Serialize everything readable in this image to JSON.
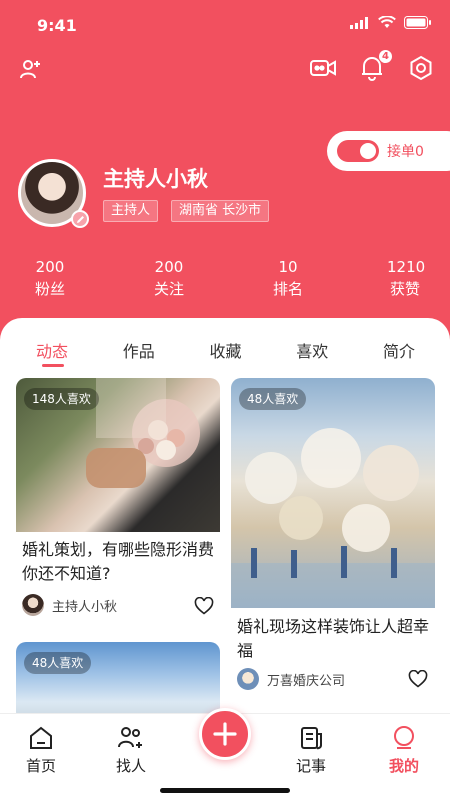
{
  "status_bar": {
    "time": "9:41"
  },
  "header": {
    "notification_count": "4",
    "order_toggle": {
      "label": "接单0",
      "on": true
    },
    "profile": {
      "name": "主持人小秋",
      "tags": [
        "主持人",
        "湖南省 长沙市"
      ]
    },
    "stats": [
      {
        "value": "200",
        "label": "粉丝"
      },
      {
        "value": "200",
        "label": "关注"
      },
      {
        "value": "10",
        "label": "排名"
      },
      {
        "value": "1210",
        "label": "获赞"
      }
    ]
  },
  "tabs": [
    "动态",
    "作品",
    "收藏",
    "喜欢",
    "简介"
  ],
  "active_tab": "动态",
  "posts": [
    {
      "likes": "148人喜欢",
      "title": "婚礼策划，有哪些隐形消费你还不知道?",
      "author": "主持人小秋"
    },
    {
      "likes": "48人喜欢",
      "title": "婚礼现场这样装饰让人超幸福",
      "author": "万喜婚庆公司"
    },
    {
      "likes": "48人喜欢",
      "title": "",
      "author": ""
    }
  ],
  "bottom_nav": [
    {
      "label": "首页",
      "icon": "home-icon"
    },
    {
      "label": "找人",
      "icon": "find-people-icon"
    },
    {
      "label": "记事",
      "icon": "notes-icon"
    },
    {
      "label": "我的",
      "icon": "profile-icon"
    }
  ],
  "active_nav": "我的",
  "colors": {
    "accent": "#f2505f",
    "white": "#ffffff",
    "text": "#222222"
  }
}
